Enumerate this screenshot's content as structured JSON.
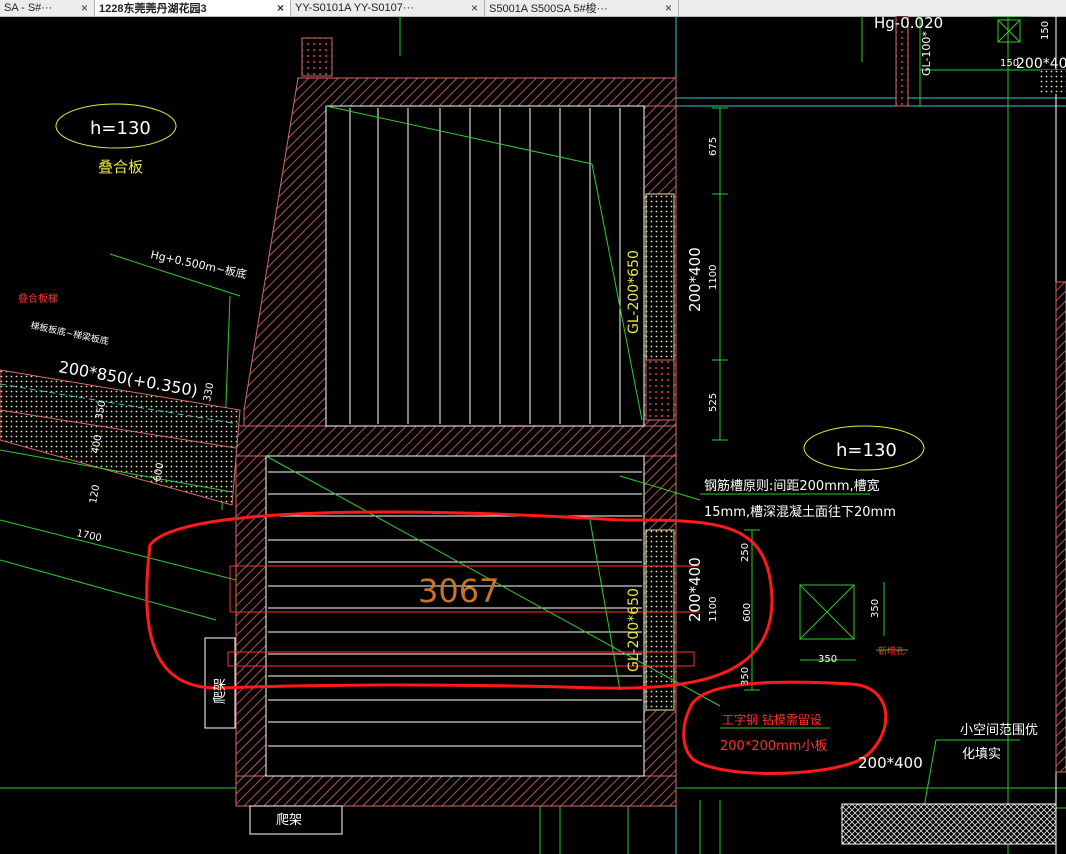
{
  "tabs": [
    {
      "label": "SA - S#···",
      "close": "×",
      "active": false
    },
    {
      "label": "1228东莞莞丹湖花园3",
      "close": "×",
      "active": true
    },
    {
      "label": "YY-S0101A YY-S0107···",
      "close": "×",
      "active": false
    },
    {
      "label": "S5001A S500SA 5#梭···",
      "close": "×",
      "active": false
    }
  ],
  "drawing": {
    "top_label": "Hg-0.020",
    "gl_top": "GL-100*",
    "dim_150a": "150",
    "dim_150b": "150",
    "dim_200_40": "200*40",
    "h130_left": "h=130",
    "h130_right": "h=130",
    "diehe_ban": "叠合板",
    "hg_note": "Hg+0.500m~板底",
    "diehe_ti": "叠合板梯",
    "ti_note": "梯板板底~梯梁板底",
    "beam_200_850": "200*850(+0.350)",
    "dim_330": "330",
    "dim_350a": "350",
    "dim_400": "400",
    "dim_600a": "600",
    "dim_120": "120",
    "dim_1700": "1700",
    "dim_675": "675",
    "dim_1100a": "1100",
    "dim_525": "525",
    "beam_200_400a": "200*400",
    "beam_200_400b": "200*400",
    "beam_200_400c": "200*400",
    "gl_200_650a": "GL-200*650",
    "gl_200_650b": "GL-200*650",
    "rebar_note_1": "钢筋槽原则:间距200mm,槽宽",
    "rebar_note_2": "15mm,槽深混凝土面往下20mm",
    "dim_3067": "3067",
    "dim_250": "250",
    "dim_1100b": "1100",
    "dim_600b": "600",
    "dim_350b": "350",
    "dim_350c": "350",
    "dim_350d": "350",
    "hole_label": "新增孔",
    "steel_note": "工字钢 钻模需留设",
    "plate_note": "200*200mm小板",
    "gap_note_1": "小空间范围优",
    "gap_note_2": "化填实",
    "climb_1": "爬架",
    "climb_2": "爬架"
  },
  "colors": {
    "background": "#000000",
    "wall_hatch": "#d96a6a",
    "green": "#2ecc2e",
    "white": "#ffffff",
    "cyan": "#36c8c8",
    "yellow": "#e8e840",
    "red_markup": "#ff1a1a",
    "orange_dim": "#c8732a"
  }
}
